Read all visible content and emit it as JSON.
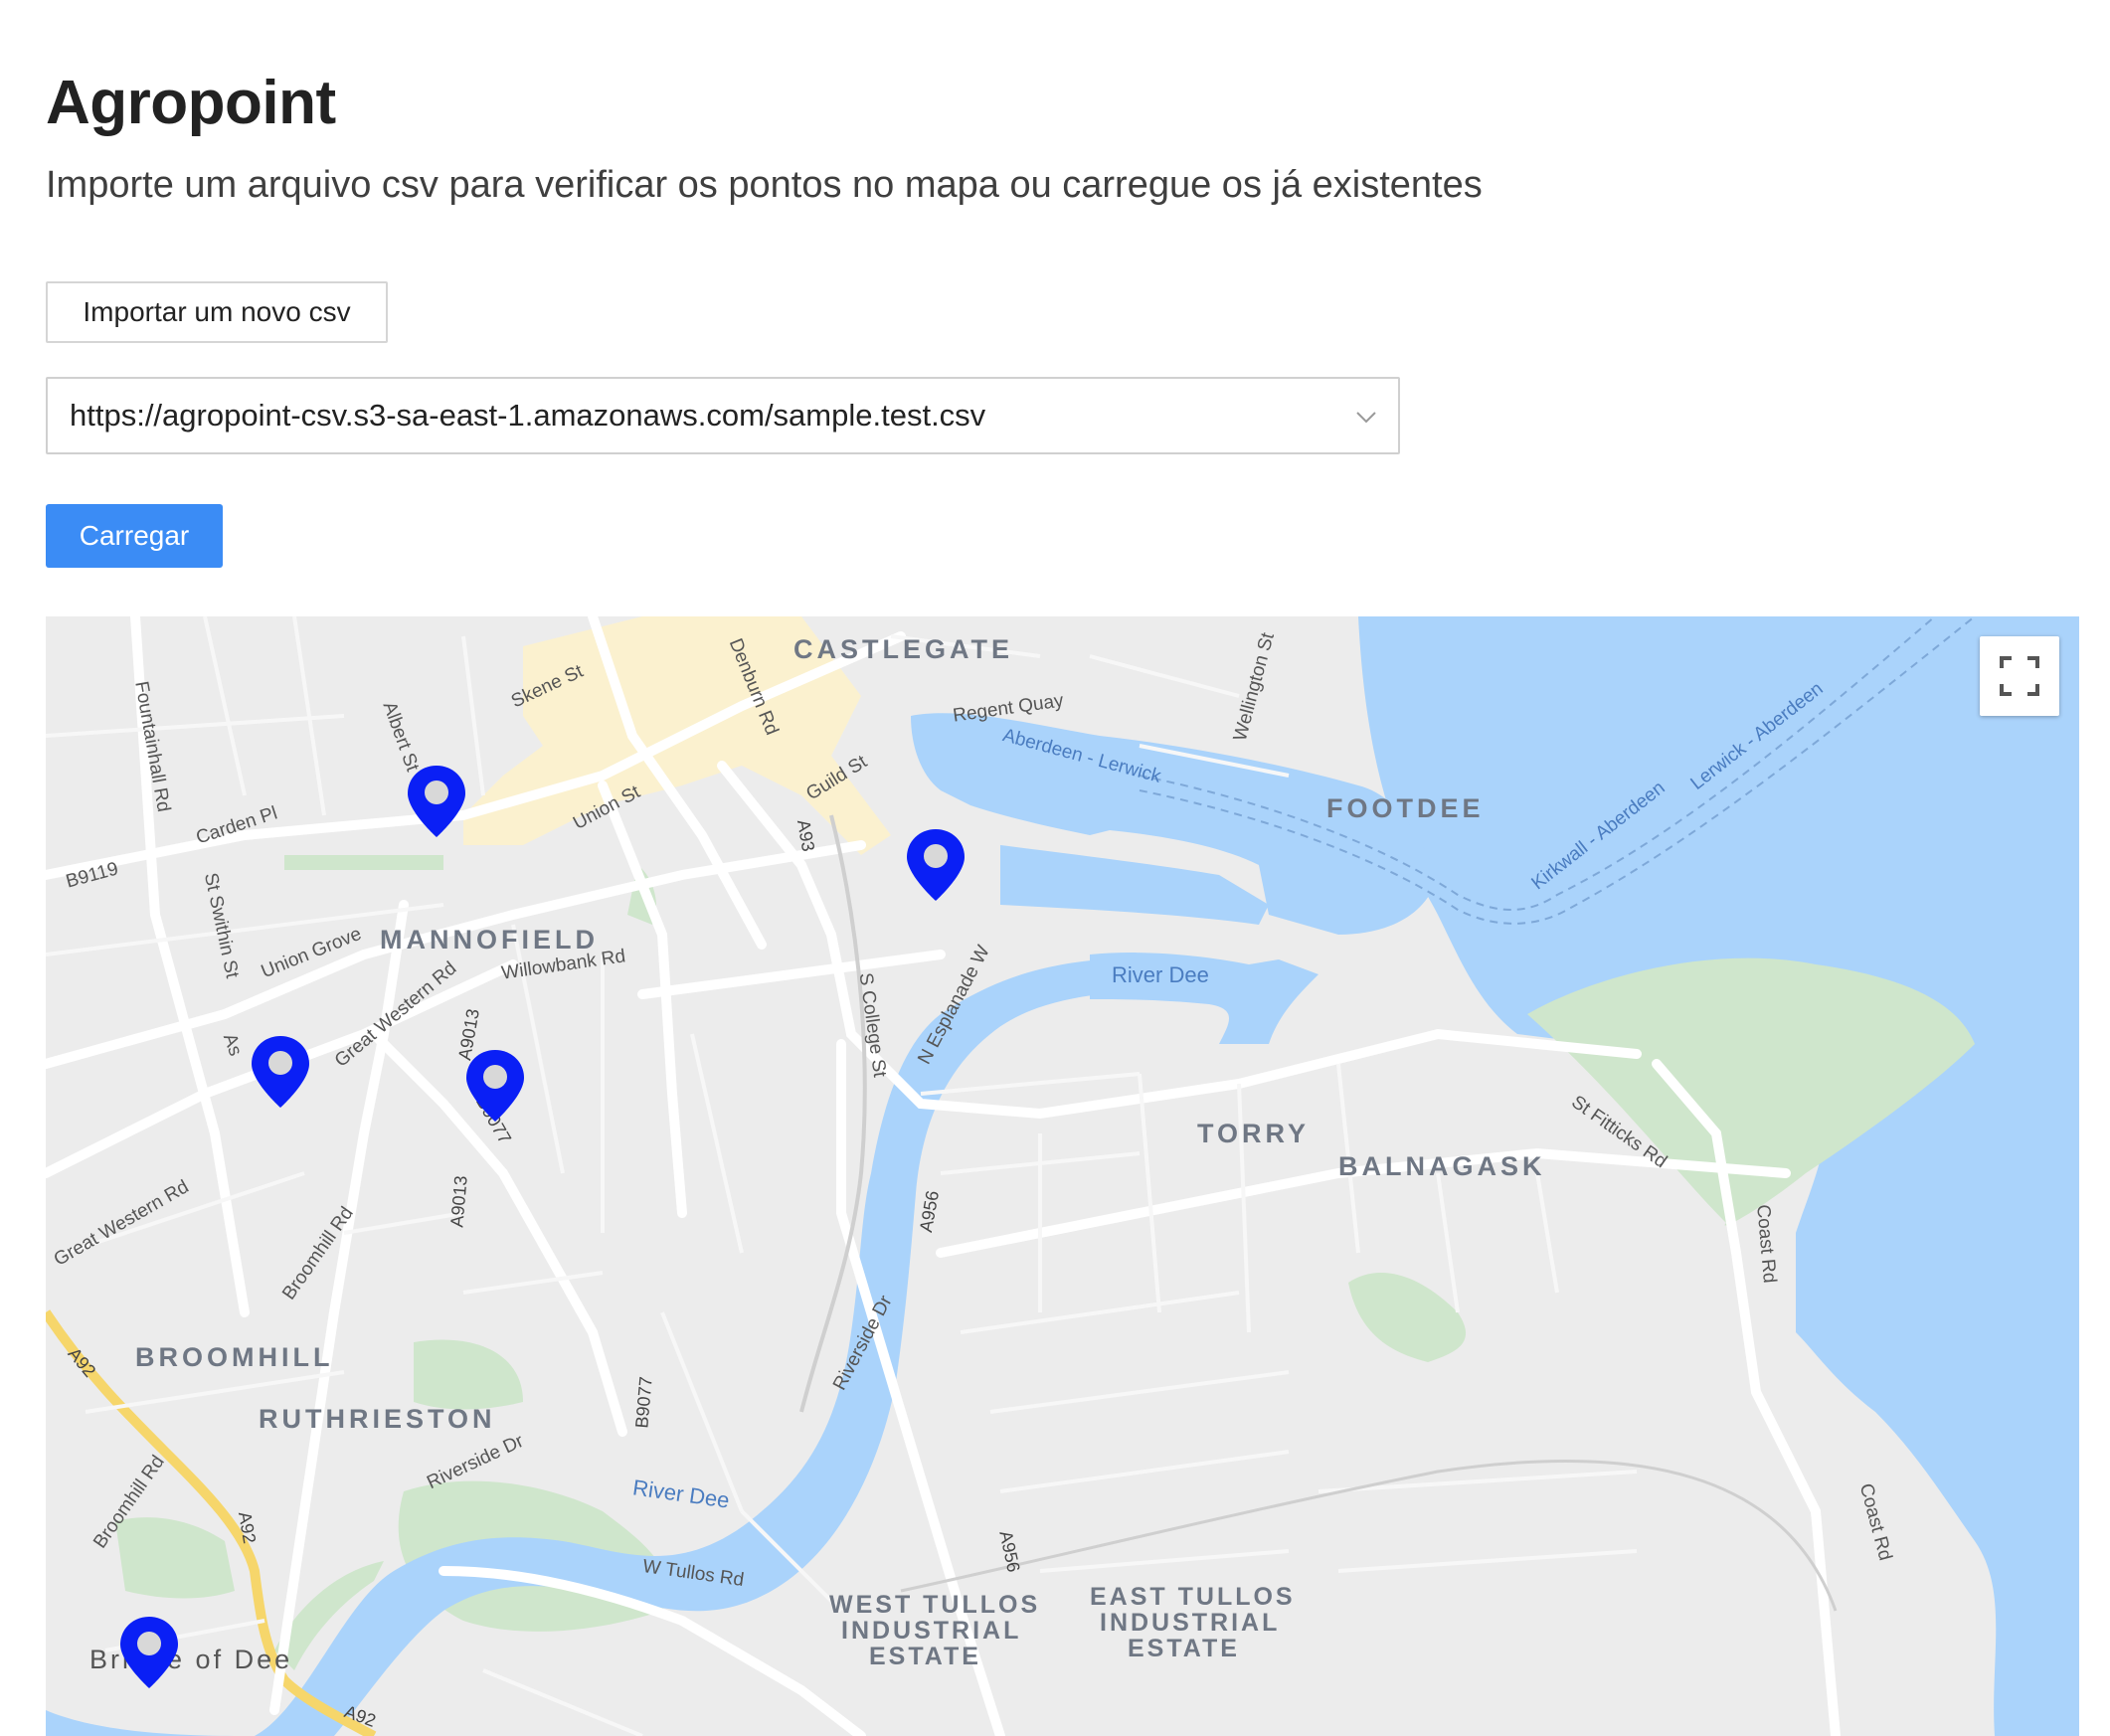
{
  "header": {
    "title": "Agropoint",
    "subtitle": "Importe um arquivo csv para verificar os pontos no mapa ou carregue os já existentes"
  },
  "controls": {
    "import_button": "Importar um novo csv",
    "csv_select_value": "https://agropoint-csv.s3-sa-east-1.amazonaws.com/sample.test.csv",
    "load_button": "Carregar"
  },
  "map": {
    "fullscreen_icon": "fullscreen-icon",
    "marker_color": "#0a1ff5",
    "water_color": "#aad3fb",
    "park_color": "#cfe6cc",
    "areas": {
      "castlegate": "CASTLEGATE",
      "footdee": "FOOTDEE",
      "mannofield": "MANNOFIELD",
      "torry": "TORRY",
      "balnagask": "BALNAGASK",
      "broomhill": "BROOMHILL",
      "ruthrieston": "RUTHRIESTON",
      "west_tullos": "WEST TULLOS",
      "east_tullos": "EAST TULLOS",
      "industrial": "INDUSTRIAL",
      "estate": "ESTATE",
      "bridge_of_dee": "Bridge of Dee"
    },
    "streets": {
      "skene_st": "Skene St",
      "denburn_rd": "Denburn Rd",
      "regent_quay": "Regent Quay",
      "wellington_st": "Wellington St",
      "fountainhall_rd": "Fountainhall Rd",
      "albert_st": "Albert St",
      "carden_pl": "Carden Pl",
      "union_st": "Union St",
      "guild_st": "Guild St",
      "b9119": "B9119",
      "st_swithin_st": "St Swithin St",
      "union_grove": "Union Grove",
      "willowbank_rd": "Willowbank Rd",
      "great_western_rd": "Great Western Rd",
      "a9013": "A9013",
      "b9077": "B9077",
      "s_college_st": "S College St",
      "n_esplanade_w": "N Esplanade W",
      "a93": "A93",
      "a956": "A956",
      "st_fitticks_rd": "St Fitticks Rd",
      "broomhill_rd": "Broomhill Rd",
      "coast_rd": "Coast Rd",
      "riverside_dr": "Riverside Dr",
      "w_tullos_rd": "W Tullos Rd",
      "a92": "A92",
      "as": "As"
    },
    "water": {
      "river_dee": "River Dee"
    },
    "ferries": {
      "aberdeen_lerwick": "Aberdeen - Lerwick",
      "kirkwall_aberdeen": "Kirkwall - Aberdeen",
      "lerwick_aberdeen": "Lerwick - Aberdeen"
    },
    "marker_count": 5
  }
}
